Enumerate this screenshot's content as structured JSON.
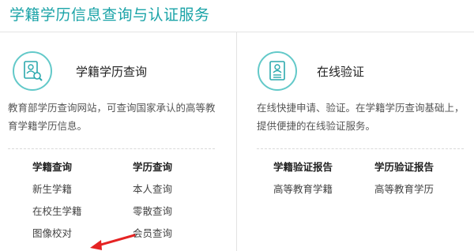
{
  "page_title": "学籍学历信息查询与认证服务",
  "colors": {
    "accent": "#1aa3a7",
    "icon_ring": "#63c9c9",
    "arrow": "#e52323"
  },
  "query_panel": {
    "icon": "document-search-icon",
    "title": "学籍学历查询",
    "desc": "教育部学历查询网站，可查询国家承认的高等教育学籍学历信息。",
    "columns": [
      {
        "heading": "学籍查询",
        "links": [
          "新生学籍",
          "在校生学籍",
          "图像校对"
        ]
      },
      {
        "heading": "学历查询",
        "links": [
          "本人查询",
          "零散查询",
          "会员查询"
        ]
      }
    ]
  },
  "verify_panel": {
    "icon": "document-verify-icon",
    "title": "在线验证",
    "desc": "在线快捷申请、验证。在学籍学历查询基础上，提供便捷的在线验证服务。",
    "columns": [
      {
        "heading": "学籍验证报告",
        "links": [
          "高等教育学籍"
        ]
      },
      {
        "heading": "学历验证报告",
        "links": [
          "高等教育学历"
        ]
      }
    ]
  },
  "annotation": {
    "arrow_target": "在校生学籍"
  }
}
